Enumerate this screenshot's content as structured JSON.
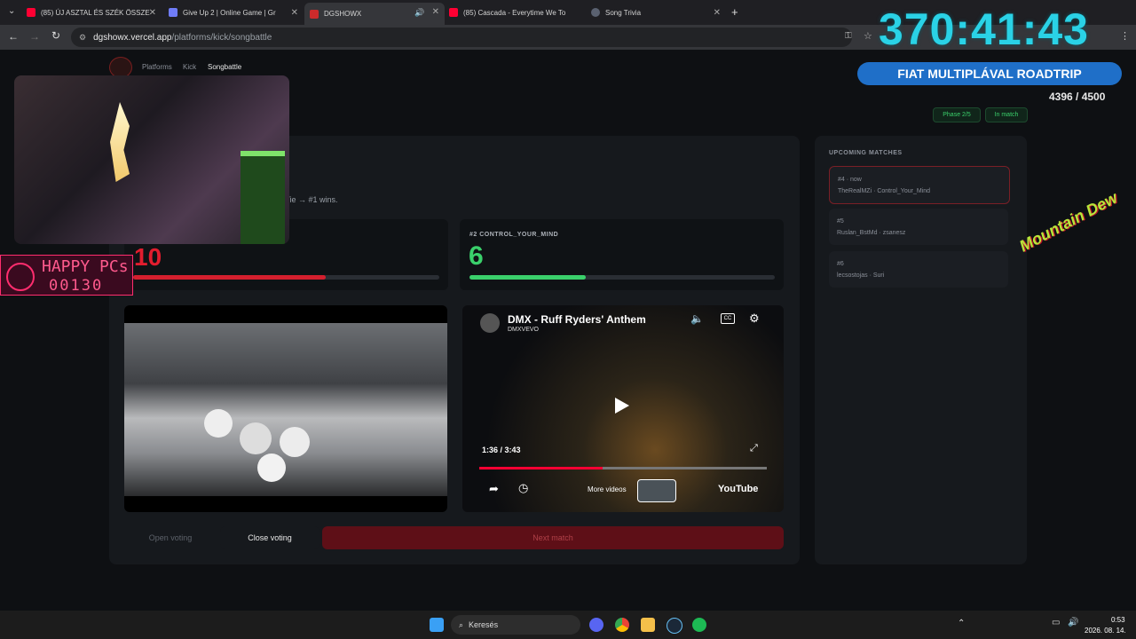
{
  "browser": {
    "tabs": [
      {
        "title": "(85) ÚJ ASZTAL ÉS SZÉK ÖSSZE",
        "favicon_color": "#ff0033"
      },
      {
        "title": "Give Up 2 | Online Game | Gr",
        "favicon_color": "#6f7cf7"
      },
      {
        "title": "DGSHOWX",
        "favicon_color": "#cc2b2b"
      },
      {
        "title": "(85) Cascada - Everytime We To",
        "favicon_color": "#ff0033"
      },
      {
        "title": "Song Trivia",
        "favicon_color": "#5a6170"
      }
    ],
    "url_host": "dgshowx.vercel.app",
    "url_path": "/platforms/kick/songbattle"
  },
  "nav": {
    "items": [
      "Platforms",
      "Kick",
      "Songbattle"
    ]
  },
  "header": {
    "phase": "Phase 2/5",
    "status": "In match"
  },
  "battle": {
    "rule_text": "ser). Tie → #1 wins.",
    "left": {
      "votes": "10",
      "progress": 0.63
    },
    "right": {
      "title": "#2 CONTROL_YOUR_MIND",
      "votes": "6",
      "progress": 0.38
    }
  },
  "video": {
    "title": "DMX - Ruff Ryders' Anthem",
    "channel": "DMXVEVO",
    "time": "1:36 / 3:43",
    "progress": 0.43,
    "more_videos": "More videos",
    "brand": "YouTube"
  },
  "controls": {
    "open_voting": "Open voting",
    "close_voting": "Close voting",
    "next_match": "Next match"
  },
  "upcoming": {
    "title": "UPCOMING MATCHES",
    "items": [
      {
        "line1": "#4 · now",
        "line2": "TheRealMZi · Control_Your_Mind"
      },
      {
        "line1": "#5",
        "line2": "Ruslan_BstMd · zsanesz"
      },
      {
        "line1": "#6",
        "line2": "lecsostojas · Suri"
      }
    ]
  },
  "overlay": {
    "timer": "370:41:43",
    "roadtrip": "FIAT MULTIPLÁVAL ROADTRIP",
    "count": "4396 / 4500",
    "happy_title": "HAPPY PCs",
    "happy_count": "00130",
    "brand": "Mountain Dew"
  },
  "taskbar": {
    "search": "Keresés",
    "time": "0:53",
    "date": "2026. 08. 14."
  },
  "colors": {
    "accent_green": "#3ad06b",
    "accent_red": "#e11d2e",
    "timer": "#2ad2e6"
  }
}
